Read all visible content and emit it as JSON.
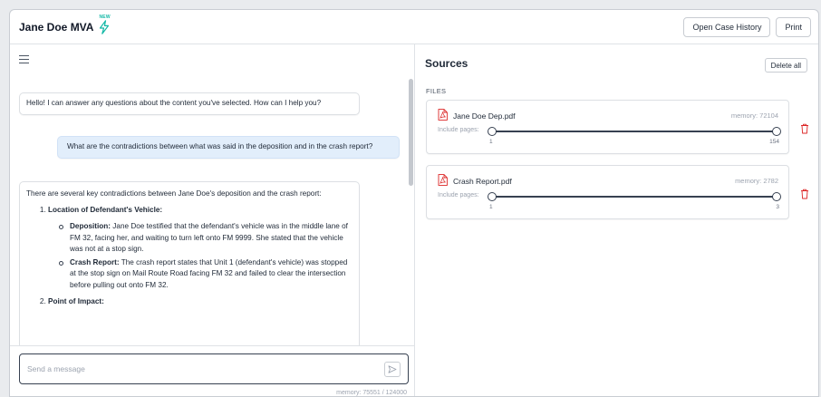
{
  "app": {
    "title": "Jane Doe MVA",
    "new_badge": "NEW"
  },
  "header": {
    "open_case_history": "Open Case History",
    "print": "Print"
  },
  "chat": {
    "assistant_greeting": "Hello! I can answer any questions about the content you've selected. How can I help you?",
    "user_question": "What are the contradictions between what was said in the deposition and in the crash report?",
    "answer": {
      "intro": "There are several key contradictions between Jane Doe's deposition and the crash report:",
      "points": [
        {
          "title": "Location of Defendant's Vehicle:",
          "bullets": [
            {
              "label": "Deposition:",
              "text": " Jane Doe testified that the defendant's vehicle was in the middle lane of FM 32, facing her, and waiting to turn left onto FM 9999. She stated that the vehicle was not at a stop sign."
            },
            {
              "label": "Crash Report:",
              "text": " The crash report states that Unit 1 (defendant's vehicle) was stopped at the stop sign on Mail Route Road facing FM 32 and failed to clear the intersection before pulling out onto FM 32."
            }
          ]
        },
        {
          "title": "Point of Impact:",
          "bullets": []
        }
      ]
    },
    "composer": {
      "placeholder": "Send a message",
      "value": ""
    },
    "memory_total": "memory: 75551 / 124000"
  },
  "sources": {
    "title": "Sources",
    "delete_all": "Delete all",
    "files_label": "FILES",
    "pages_label": "Include pages:",
    "files": [
      {
        "name": "Jane Doe Dep.pdf",
        "memory": "memory: 72104",
        "min_page": "1",
        "max_page": "154"
      },
      {
        "name": "Crash Report.pdf",
        "memory": "memory: 2782",
        "min_page": "1",
        "max_page": "3"
      }
    ]
  },
  "colors": {
    "accent_teal": "#14b8a6",
    "user_bubble": "#e2eefb",
    "delete_red": "#dc2626",
    "pdf_red": "#dc2626"
  },
  "icons": [
    "menu-icon",
    "lightning-icon",
    "send-icon",
    "pdf-file-icon",
    "trash-icon"
  ]
}
